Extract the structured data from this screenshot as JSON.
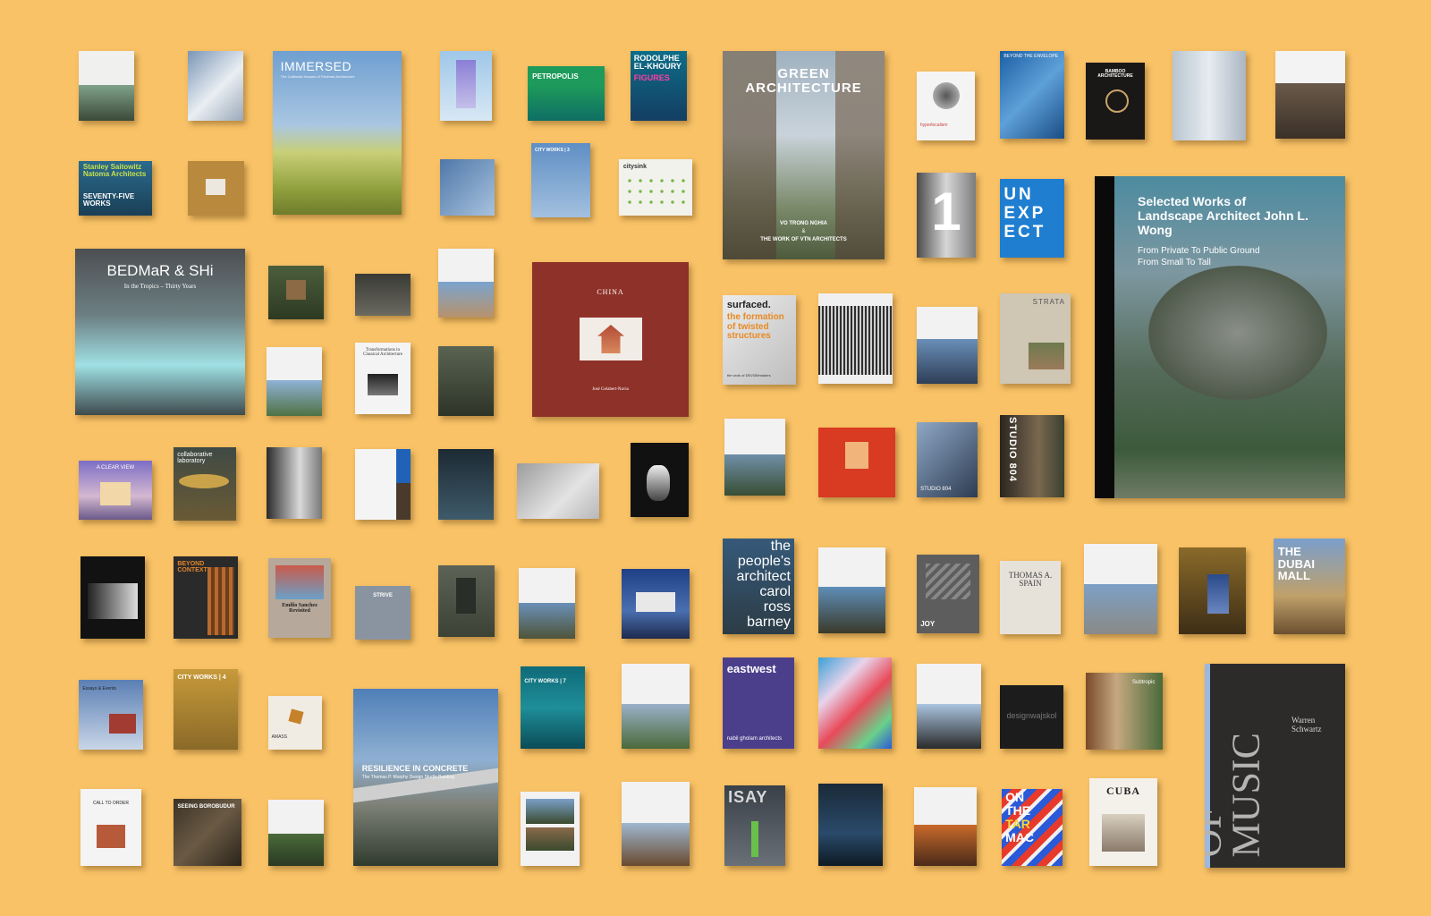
{
  "books": {
    "immersed": {
      "title": "IMMERSED",
      "subtitle": "The California Houses of Feldman Architecture"
    },
    "rodolphe": {
      "title": "RODOLPHE EL-KHOURY",
      "subtitle": "FIGURES"
    },
    "green": {
      "title": "GREEN ARCHITECTURE",
      "author": "VO TRONG NGHIA",
      "amp": "&",
      "subtitle": "THE WORK OF VTN ARCHITECTS"
    },
    "beyond_envelope": {
      "title": "BEYOND THE ENVELOPE"
    },
    "bamboo": {
      "title": "BAMBOO ARCHITECTURE"
    },
    "hyper": {
      "title": "hyperlocalism"
    },
    "petropolis": {
      "title": "PETROPOLIS"
    },
    "stanley": {
      "title": "Stanley Saitowitz Natoma Architects",
      "subtitle": "SEVENTY-FIVE WORKS"
    },
    "city_works_3": {
      "title": "CITY WORKS | 3"
    },
    "city_sink": {
      "title": "citysink"
    },
    "one": {
      "title": "1"
    },
    "unexpect": {
      "line1": "UN",
      "line2": "EXP",
      "line3": "ECT"
    },
    "wong": {
      "title": "Selected Works of Landscape Architect John L. Wong",
      "subtitle_1": "From Private To Public Ground",
      "subtitle_2": "From Small To Tall"
    },
    "bedmar": {
      "title": "BEDMaR & SHi",
      "subtitle": "In the Tropics – Thirty Years"
    },
    "china": {
      "title": "CHINA",
      "author": "José Gelabert-Navia"
    },
    "surfaced": {
      "title": "surfaced.",
      "subtitle": "the formation of twisted structures",
      "footer": "the work of DEVI3Mmakers"
    },
    "transformations": {
      "title": "Transformations in Classical Architecture"
    },
    "strata": {
      "title": "STRATA"
    },
    "studio_804": {
      "title": "STUDIO 804",
      "cover_label": "STUDIO 804"
    },
    "clear_view": {
      "title": "A CLEAR VIEW"
    },
    "collaborative": {
      "title": "collaborative laboratory"
    },
    "beyond_context": {
      "title": "BEYOND CONTEXT"
    },
    "emilio": {
      "title": "Emilio Sanchez Revisited"
    },
    "strive": {
      "title": "STRIVE"
    },
    "peoples": {
      "line1": "the",
      "line2": "people's",
      "line3": "architect",
      "line4": "carol",
      "line5": "ross",
      "line6": "barney"
    },
    "joy": {
      "title": "JOY"
    },
    "thomas": {
      "title": "THOMAS A. SPAIN"
    },
    "dubai": {
      "title": "THE DUBAI MALL"
    },
    "essays": {
      "title": "Essays & Events"
    },
    "city_works_4": {
      "title": "CITY WORKS | 4"
    },
    "amass": {
      "title": "AMASS"
    },
    "resilience": {
      "title": "RESILIENCE IN CONCRETE",
      "subtitle": "The Thomas P. Murphy Design Studio Building"
    },
    "city_works_7": {
      "title": "CITY WORKS | 7"
    },
    "eastwest": {
      "title": "eastwest",
      "author": "nabil gholam   architects"
    },
    "designwajskol": {
      "title": "designwajskol"
    },
    "subtropic": {
      "title": "Subtropic"
    },
    "shape_music": {
      "title": "THE SHAPE OF MUSIC",
      "author": "Warren Schwartz"
    },
    "call_order": {
      "title": "CALL TO ORDER"
    },
    "borobudur": {
      "title": "SEEING BOROBUDUR"
    },
    "isay": {
      "title": "ISAY"
    },
    "on_tarmac": {
      "line1": "ON",
      "line2": "THE",
      "line3": "TAR",
      "line4": "MAC"
    },
    "cuba": {
      "title": "CUBA"
    }
  },
  "colors": {
    "background": "#f9c266",
    "china_red": "#8e3128",
    "eastwest_purple": "#4b3f8c",
    "shape_music_dark": "#2c2b2a"
  }
}
